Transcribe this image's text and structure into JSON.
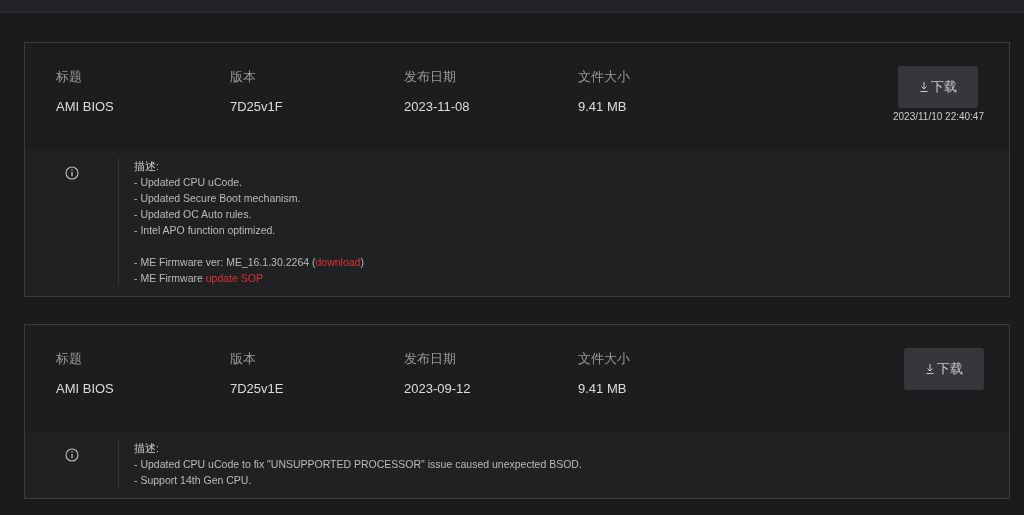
{
  "cards": [
    {
      "columns": [
        {
          "label": "标题",
          "value": "AMI BIOS"
        },
        {
          "label": "版本",
          "value": "7D25v1F"
        },
        {
          "label": "发布日期",
          "value": "2023-11-08"
        },
        {
          "label": "文件大小",
          "value": "9.41 MB"
        }
      ],
      "download_button": "下载",
      "timestamp": "2023/11/10 22:40:47",
      "description": {
        "heading": "描述:",
        "paragraphs": [
          [
            [
              {
                "kind": "text",
                "text": "- Updated CPU uCode."
              }
            ],
            [
              {
                "kind": "text",
                "text": "- Updated Secure Boot mechanism."
              }
            ],
            [
              {
                "kind": "text",
                "text": "- Updated OC Auto rules."
              }
            ],
            [
              {
                "kind": "text",
                "text": "- Intel APO function optimized."
              }
            ]
          ],
          [
            [
              {
                "kind": "text",
                "text": "- ME Firmware ver: ME_16.1.30.2264 ("
              },
              {
                "kind": "link",
                "text": "download"
              },
              {
                "kind": "text",
                "text": ")"
              }
            ],
            [
              {
                "kind": "text",
                "text": "- ME Firmware "
              },
              {
                "kind": "link",
                "text": "update SOP"
              }
            ]
          ]
        ]
      }
    },
    {
      "columns": [
        {
          "label": "标题",
          "value": "AMI BIOS"
        },
        {
          "label": "版本",
          "value": "7D25v1E"
        },
        {
          "label": "发布日期",
          "value": "2023-09-12"
        },
        {
          "label": "文件大小",
          "value": "9.41 MB"
        }
      ],
      "download_button": "下载",
      "description": {
        "heading": "描述:",
        "paragraphs": [
          [
            [
              {
                "kind": "text",
                "text": "- Updated CPU uCode to fix \"UNSUPPORTED PROCESSOR\" issue caused unexpected BSOD."
              }
            ],
            [
              {
                "kind": "text",
                "text": "- Support 14th Gen CPU."
              }
            ]
          ]
        ]
      }
    }
  ]
}
